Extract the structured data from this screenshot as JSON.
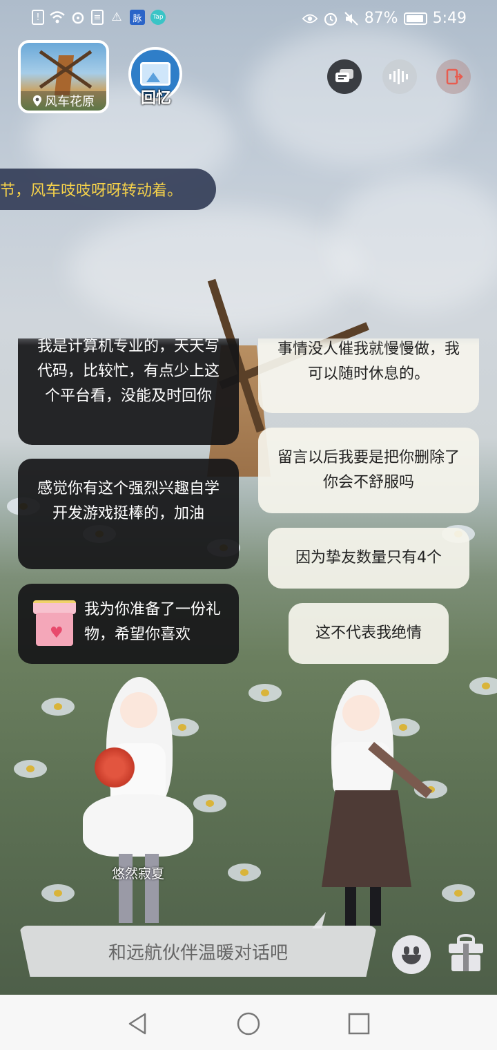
{
  "status_bar": {
    "battery": "87%",
    "time": "5:49",
    "left_icons": [
      "notification-icon",
      "wifi-icon",
      "weibo-icon",
      "file-icon",
      "warning-icon",
      "mai-app-icon",
      "taptap-icon"
    ],
    "right_icons": [
      "eye-icon",
      "alarm-icon",
      "mute-icon",
      "battery-icon"
    ],
    "mai_glyph": "脉",
    "tap_glyph": "Tap"
  },
  "location": {
    "name": "风车花原"
  },
  "memory": {
    "label": "回忆"
  },
  "narration": "节，风车吱吱呀呀转动着。",
  "chat": {
    "left": [
      {
        "text": "我是计算机专业的，天天写代码，比较忙，有点少上这个平台看，没能及时回你"
      },
      {
        "text": "感觉你有这个强烈兴趣自学开发游戏挺棒的，加油"
      },
      {
        "text": "我为你准备了一份礼物，希望你喜欢",
        "gift": true
      }
    ],
    "right": [
      {
        "text": "事情没人催我就慢慢做，我可以随时休息的。"
      },
      {
        "text": "留言以后我要是把你删除了你会不舒服吗"
      },
      {
        "text": "因为挚友数量只有4个"
      },
      {
        "text": "这不代表我绝情"
      }
    ]
  },
  "character": {
    "name": "悠然寂夏"
  },
  "input": {
    "placeholder": "和远航伙伴温暖对话吧"
  },
  "colors": {
    "narration_text": "#f6d24a",
    "narration_bg": "#343e58",
    "left_bubble": "#161618",
    "right_bubble": "#f5f4ec"
  }
}
